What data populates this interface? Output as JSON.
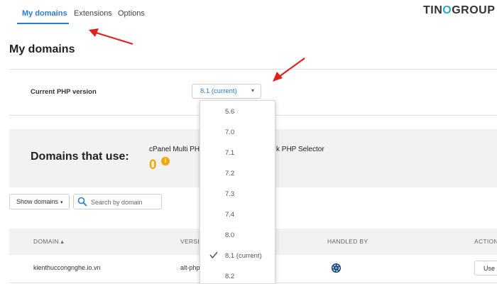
{
  "tabs": [
    {
      "label": "My domains",
      "active": true
    },
    {
      "label": "Extensions",
      "active": false
    },
    {
      "label": "Options",
      "active": false
    }
  ],
  "logo": {
    "text_prefix": "TIN",
    "text_dot": "O",
    "text_suffix": "GROUP"
  },
  "page_title": "My domains",
  "php": {
    "label": "Current PHP version",
    "selected": "8.1 (current)",
    "options": [
      "5.6",
      "7.0",
      "7.1",
      "7.2",
      "7.3",
      "7.4",
      "8.0",
      "8.1 (current)",
      "8.2"
    ],
    "selected_index": 7
  },
  "domains_panel": {
    "title": "Domains that use:",
    "selector_text_a": "cPanel Multi PH",
    "selector_text_b": "k PHP Selector",
    "count": "0",
    "info_glyph": "i"
  },
  "controls": {
    "show_domains_label": "Show domains",
    "search_placeholder": "Search by domain"
  },
  "table": {
    "headers": {
      "domain": "DOMAIN ▴",
      "version": "VERSIO",
      "handled_by": "HANDLED BY",
      "actions": "ACTION"
    },
    "rows": [
      {
        "domain": "kienthuccongnghe.io.vn",
        "version": "alt-php",
        "handled_by_icon": "cloudlinux-icon",
        "action_label": "Use I"
      }
    ]
  },
  "colors": {
    "accent": "#2a7ad8",
    "warning": "#f1a800",
    "annotation_arrow": "#e02020"
  }
}
